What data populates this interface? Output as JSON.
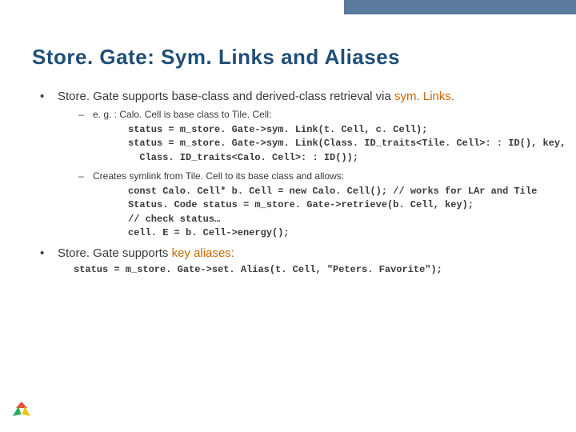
{
  "title": "Store. Gate:  Sym. Links and Aliases",
  "bullets": [
    {
      "text_pre": "Store. Gate supports base-class and derived-class retrieval via ",
      "text_hl": "sym. Links.",
      "subs": [
        {
          "text": "e. g. : Calo. Cell is base class to Tile. Cell:",
          "code": [
            "status = m_store. Gate->sym. Link(t. Cell, c. Cell);",
            "status = m_store. Gate->sym. Link(Class. ID_traits<Tile. Cell>: : ID(), key,",
            "  Class. ID_traits<Calo. Cell>: : ID());"
          ]
        },
        {
          "text": "Creates symlink from Tile. Cell to its base class and allows:",
          "code": [
            "const Calo. Cell* b. Cell = new Calo. Cell(); // works for LAr and Tile",
            "Status. Code status = m_store. Gate->retrieve(b. Cell, key);",
            "// check status…",
            "cell. E = b. Cell->energy();"
          ]
        }
      ]
    },
    {
      "text_pre": "Store. Gate supports ",
      "text_hl": "key aliases:",
      "code": [
        "status = m_store. Gate->set. Alias(t. Cell, \"Peters. Favorite\");"
      ]
    }
  ]
}
